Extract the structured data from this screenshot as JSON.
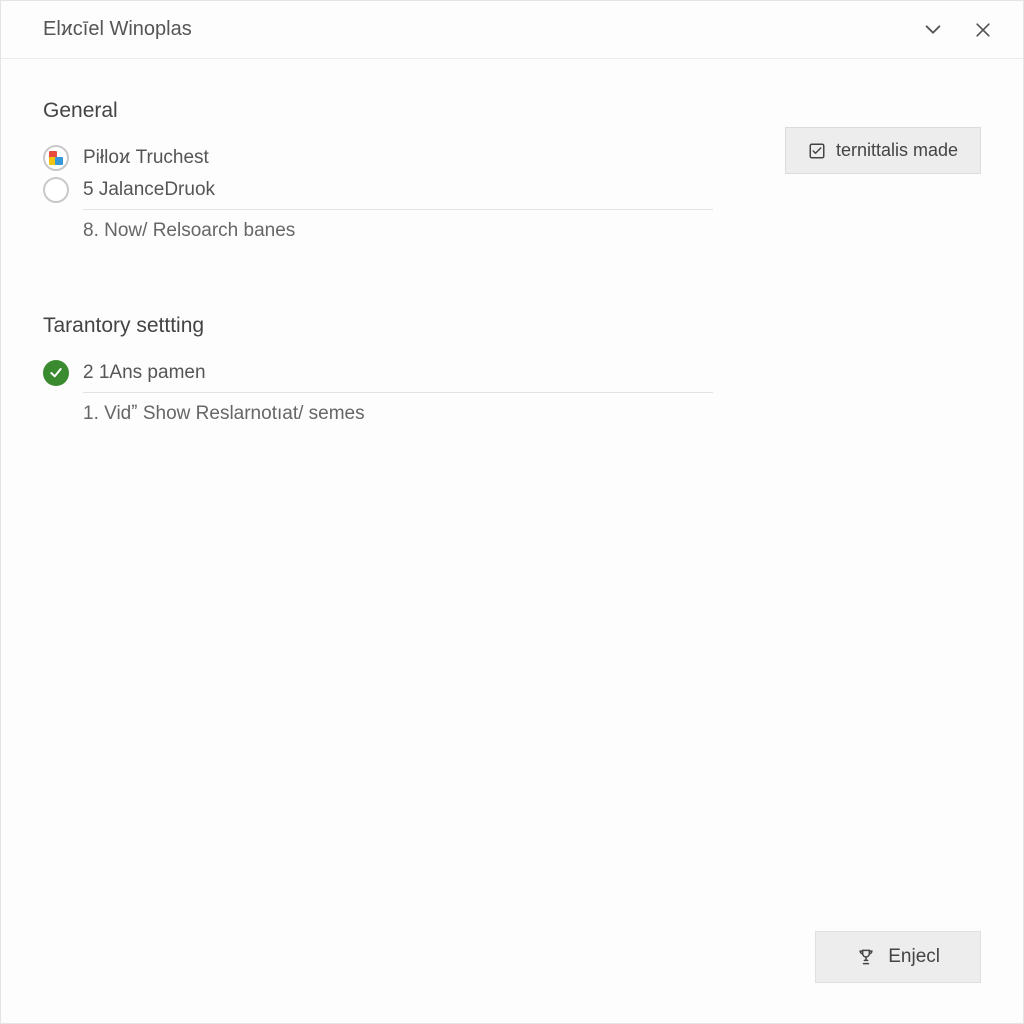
{
  "window": {
    "title": "Elϰcīel Winoplas"
  },
  "sections": {
    "general": {
      "title": "General",
      "items": [
        {
          "label": "Piłloϰ Truchest"
        },
        {
          "label": "5 JalanceDruok"
        }
      ],
      "subline": "8. Now/ Relsoarch banes"
    },
    "tarantory": {
      "title": "Tarantory settting",
      "items": [
        {
          "label": "2 1Ans pamen"
        }
      ],
      "subline": "1. Vidˮ Show Reslarnotıat/ semes"
    }
  },
  "side_button": {
    "label": "ternittalis made"
  },
  "footer_button": {
    "label": "Enjecl"
  }
}
